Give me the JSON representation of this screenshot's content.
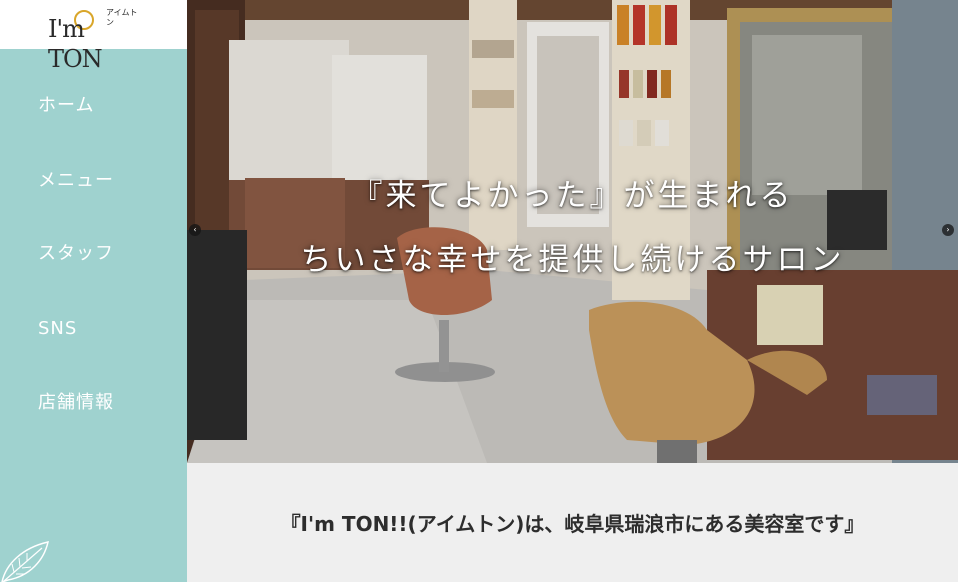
{
  "logo": {
    "main_text": "I'm TON",
    "sub_text": "アイムトン"
  },
  "nav": {
    "items": [
      {
        "label": "ホーム"
      },
      {
        "label": "メニュー"
      },
      {
        "label": "スタッフ"
      },
      {
        "label": "SNS"
      },
      {
        "label": "店舗情報"
      }
    ]
  },
  "hero": {
    "caption_line1": "『来てよかった』が生まれる",
    "caption_line2": "ちいさな幸せを提供し続けるサロン",
    "prev_arrow": "‹",
    "next_arrow": "›"
  },
  "intro": {
    "text": "『I'm TON!!(アイムトン)は、岐阜県瑞浪市にある美容室です』"
  },
  "colors": {
    "sidebar": "#9fd2cf",
    "intro_background": "#efefef",
    "logo_accent": "#d9a62a"
  },
  "icons": {
    "leaf": "leaf-icon",
    "prev": "chevron-left-icon",
    "next": "chevron-right-icon"
  }
}
